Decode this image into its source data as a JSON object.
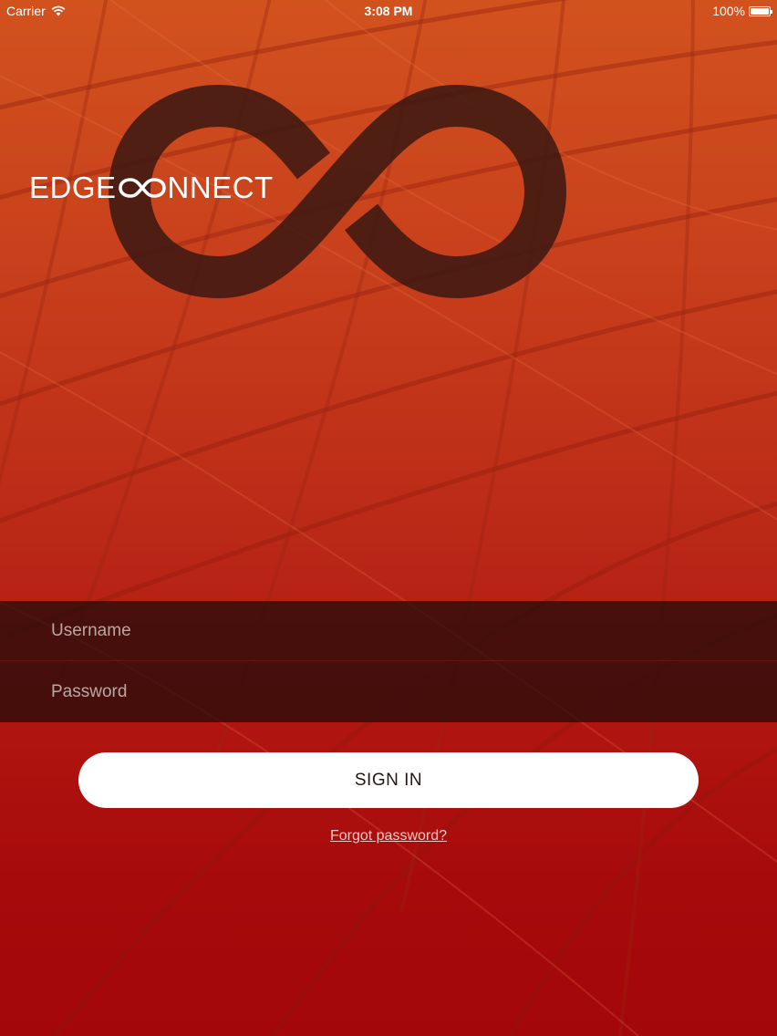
{
  "status_bar": {
    "carrier": "Carrier",
    "time": "3:08 PM",
    "battery_text": "100%",
    "battery_level": 1.0
  },
  "logo": {
    "text_before": "EDGE",
    "text_after": "NNECT"
  },
  "form": {
    "username_placeholder": "Username",
    "username_value": "",
    "password_placeholder": "Password",
    "password_value": "",
    "signin_label": "SIGN IN",
    "forgot_label": "Forgot password?"
  },
  "icons": {
    "wifi": "wifi-icon",
    "battery": "battery-icon",
    "logo_mark": "infinity-logo-icon"
  },
  "colors": {
    "background_top": "#d2521e",
    "background_bottom": "#a3070a",
    "field_background": "#2a0c0a",
    "button_background": "#ffffff",
    "button_text": "#231816",
    "logo_mark": "#3a1712"
  }
}
